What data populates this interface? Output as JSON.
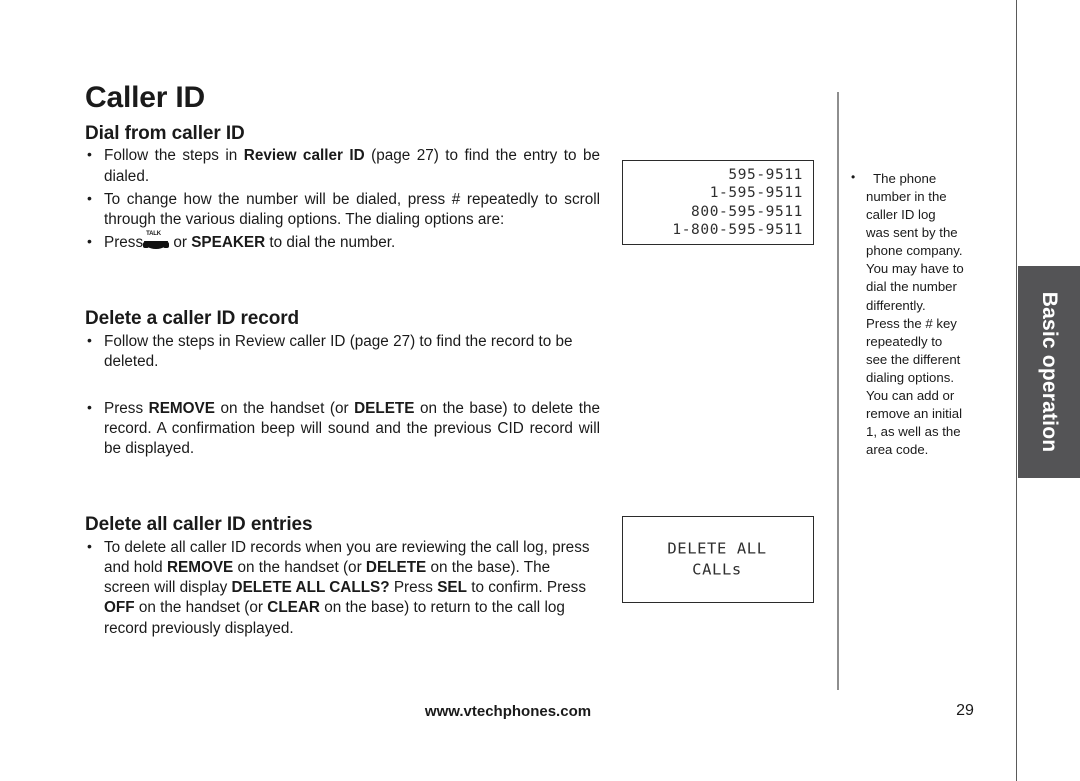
{
  "page": {
    "title": "Caller ID",
    "tab_label": "Basic operation",
    "footer_site": "www.vtechphones.com",
    "footer_page": "29",
    "accent_tab_color": "#545456",
    "rule_color": "#8e8e8e"
  },
  "sections": [
    {
      "heading": "Dial from caller ID",
      "bullets": [
        {
          "parts": [
            {
              "text": "Follow the steps in ",
              "bold": false
            },
            {
              "text": "Review caller ID",
              "bold": true
            },
            {
              "text": " (page 27) to find the entry to be dialed.",
              "bold": false
            }
          ]
        },
        {
          "parts": [
            {
              "text": "To change how the number will be dialed, press # repeatedly to scroll through the various dialing options. The dialing options are:",
              "bold": false
            }
          ]
        },
        {
          "icon": "talk-handset-icon",
          "icon_label": "TALK",
          "parts": [
            {
              "text": "Press",
              "bold": false
            },
            {
              "text": " or ",
              "bold": false
            },
            {
              "text": "SPEAKER",
              "bold": true
            },
            {
              "text": " to dial the number.",
              "bold": false
            }
          ]
        }
      ]
    },
    {
      "heading": "Delete a caller ID record",
      "bullets": [
        {
          "parts": [
            {
              "text": "Follow the steps in Review caller ID (page 27) to find the record to be deleted.",
              "bold": false
            }
          ]
        },
        {
          "parts": [
            {
              "text": "Press ",
              "bold": false
            },
            {
              "text": "REMOVE",
              "bold": true
            },
            {
              "text": " on the handset (or ",
              "bold": false
            },
            {
              "text": "DELETE",
              "bold": true
            },
            {
              "text": " on the base) to delete the record. A confirmation beep will sound and the previous CID record will be displayed.",
              "bold": false
            }
          ]
        }
      ]
    },
    {
      "heading": "Delete all caller ID entries",
      "bullets": [
        {
          "parts": [
            {
              "text": "To delete all caller ID records when you are reviewing the call log, press and hold ",
              "bold": false
            },
            {
              "text": "REMOVE",
              "bold": true
            },
            {
              "text": " on the handset (or ",
              "bold": false
            },
            {
              "text": "DELETE",
              "bold": true
            },
            {
              "text": " on the base). The screen will display ",
              "bold": false
            },
            {
              "text": "DELETE ALL CALLS?",
              "bold": true
            },
            {
              "text": " Press ",
              "bold": false
            },
            {
              "text": "SEL",
              "bold": true
            },
            {
              "text": " to confirm. Press ",
              "bold": false
            },
            {
              "text": "OFF",
              "bold": true
            },
            {
              "text": " on the handset (or ",
              "bold": false
            },
            {
              "text": "CLEAR",
              "bold": true
            },
            {
              "text": " on the base) to return to the call log record previously displayed.",
              "bold": false
            }
          ]
        }
      ]
    }
  ],
  "lcd_screens": [
    {
      "id": "dial-options",
      "align": "right",
      "lines": [
        "595-9511",
        "1-595-9511",
        "800-595-9511",
        "1-800-595-9511"
      ]
    },
    {
      "id": "delete-all-confirm",
      "align": "center",
      "lines": [
        "DELETE ALL",
        "CALLs"
      ]
    }
  ],
  "note": {
    "lines": [
      "The phone",
      "number in the",
      "caller ID log",
      "was sent by the",
      "phone company.",
      "You may have to",
      "dial the number",
      "differently.",
      "Press the # key",
      "repeatedly to",
      "see the different",
      "dialing options.",
      "You can add or",
      "remove an initial",
      "1, as well as the",
      "area code."
    ]
  }
}
